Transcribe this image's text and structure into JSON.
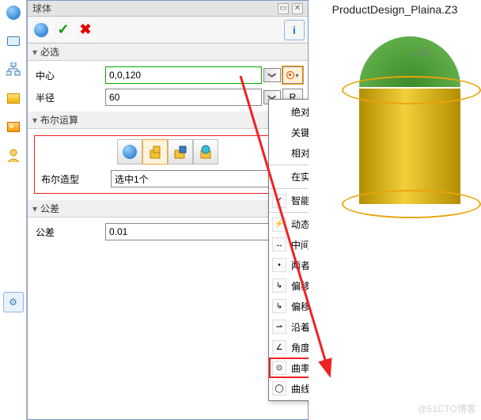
{
  "panel": {
    "title": "球体",
    "win_icons": {
      "a": "▭",
      "b": "✕"
    },
    "actions": {
      "ok": "✓",
      "cancel": "✖",
      "info": "i"
    },
    "sections": {
      "required": "必选",
      "boolean": "布尔运算",
      "tolerance": "公差"
    },
    "center": {
      "label": "中心",
      "value": "0,0,120",
      "chev": "❯"
    },
    "radius": {
      "label": "半径",
      "value": "60",
      "chev": "❯",
      "unit": "R"
    },
    "boolean": {
      "shape_label": "布尔造型",
      "shape_value": "选中1个"
    },
    "tolerance": {
      "label": "公差",
      "value": "0.01"
    }
  },
  "menu": {
    "items": [
      {
        "label": "绝对",
        "ico": ""
      },
      {
        "label": "关键点",
        "ico": ""
      },
      {
        "label": "相对",
        "ico": ""
      },
      {
        "label": "在实体上",
        "ico": "",
        "sep": true
      },
      {
        "label": "智能点参考",
        "ico": "✓",
        "sep": true
      },
      {
        "label": "动态拾取",
        "ico": "⚡",
        "sep": true
      },
      {
        "label": "中间",
        "ico": "↔"
      },
      {
        "label": "两者之间",
        "ico": "•"
      },
      {
        "label": "偏移",
        "ico": "↳"
      },
      {
        "label": "偏移距离",
        "ico": "↳"
      },
      {
        "label": "沿着",
        "ico": "⇀"
      },
      {
        "label": "角度",
        "ico": "∠"
      },
      {
        "label": "曲率中心",
        "ico": "⊙",
        "hl": true
      },
      {
        "label": "曲线象限点",
        "ico": "◯"
      }
    ]
  },
  "canvas": {
    "doc": "ProductDesign_Plaina.Z3",
    "dim": "60",
    "watermark": "@51CTO博客"
  },
  "left": [
    "sphere",
    "topo",
    "tree",
    "box",
    "image",
    "user",
    "settings"
  ]
}
